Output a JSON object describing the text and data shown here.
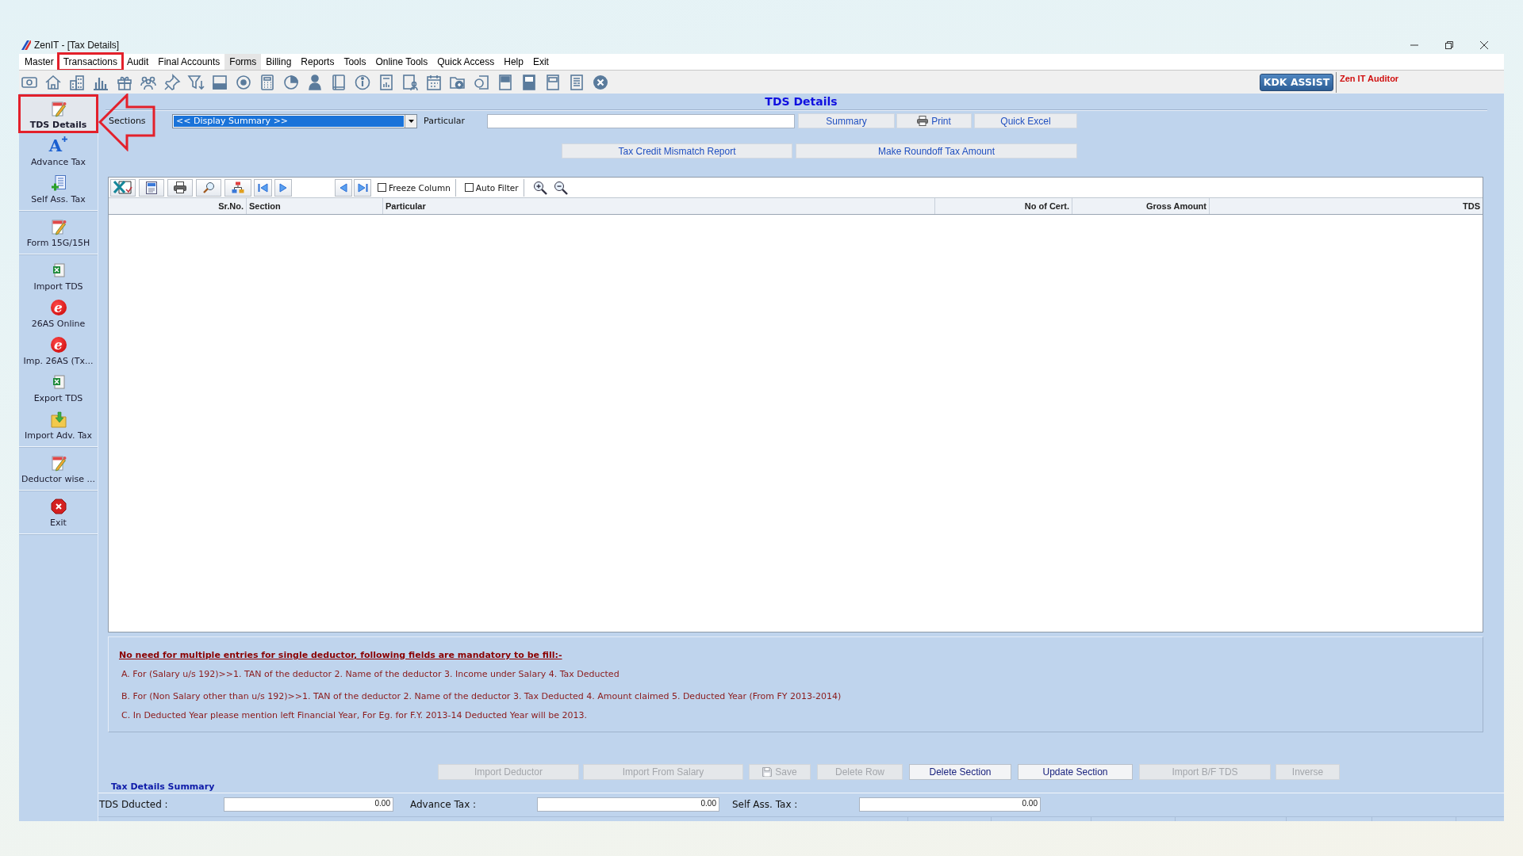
{
  "window": {
    "title": "ZenIT - [Tax Details]"
  },
  "menu": [
    {
      "label": "Master",
      "hover": false,
      "annotated": false
    },
    {
      "label": "Transactions",
      "hover": false,
      "annotated": true
    },
    {
      "label": "Audit",
      "hover": false,
      "annotated": false
    },
    {
      "label": "Final Accounts",
      "hover": false,
      "annotated": false
    },
    {
      "label": "Forms",
      "hover": true,
      "annotated": false
    },
    {
      "label": "Billing",
      "hover": false,
      "annotated": false
    },
    {
      "label": "Reports",
      "hover": false,
      "annotated": false
    },
    {
      "label": "Tools",
      "hover": false,
      "annotated": false
    },
    {
      "label": "Online Tools",
      "hover": false,
      "annotated": false
    },
    {
      "label": "Quick Access",
      "hover": false,
      "annotated": false
    },
    {
      "label": "Help",
      "hover": false,
      "annotated": false
    },
    {
      "label": "Exit",
      "hover": false,
      "annotated": false
    }
  ],
  "toolbar": {
    "assist_button": "KDK ASSIST",
    "product": "Zen IT Auditor"
  },
  "sidebar": {
    "groups": [
      {
        "items": [
          {
            "label": "TDS Details",
            "kind": "tax-note",
            "selected": true,
            "annotated": true
          },
          {
            "label": "Advance Tax",
            "kind": "glyph",
            "glyph": "A",
            "selected": false,
            "annotated": false
          },
          {
            "label": "Self Ass. Tax",
            "kind": "document-plus",
            "selected": false,
            "annotated": false
          }
        ]
      },
      {
        "items": [
          {
            "label": "Form 15G/15H",
            "kind": "tax-note",
            "selected": false,
            "annotated": false
          }
        ]
      },
      {
        "items": [
          {
            "label": "Import TDS",
            "kind": "spreadsheet",
            "selected": false,
            "annotated": false
          },
          {
            "label": "26AS Online",
            "kind": "e-logo",
            "glyph": "e",
            "selected": false,
            "annotated": false
          },
          {
            "label": "Imp. 26AS (Tx...",
            "kind": "e-logo",
            "glyph": "e",
            "selected": false,
            "annotated": false
          },
          {
            "label": "Export TDS",
            "kind": "spreadsheet",
            "selected": false,
            "annotated": false
          },
          {
            "label": "Import Adv. Tax",
            "kind": "folder-arrow",
            "selected": false,
            "annotated": false
          }
        ]
      },
      {
        "items": [
          {
            "label": "Deductor wise ...",
            "kind": "tax-note",
            "selected": false,
            "annotated": false
          }
        ]
      },
      {
        "items": [
          {
            "label": "Exit",
            "kind": "stop",
            "selected": false,
            "annotated": false
          }
        ]
      }
    ]
  },
  "heading": "TDS Details",
  "filters": {
    "sections_label": "Sections",
    "sections_value": "<< Display Summary >>",
    "particular_label": "Particular"
  },
  "top_buttons": [
    {
      "label": "Summary",
      "kind": "plain"
    },
    {
      "label": "Print",
      "kind": "print"
    },
    {
      "label": "Quick Excel",
      "kind": "plain"
    }
  ],
  "report_buttons": [
    "Tax Credit Mismatch Report",
    "Make Roundoff Tax Amount"
  ],
  "grid": {
    "options": [
      {
        "label": "Freeze Column",
        "checked": false
      },
      {
        "label": "Auto Filter",
        "checked": false
      }
    ],
    "columns": [
      {
        "label": "Sr.No.",
        "kind": "number"
      },
      {
        "label": "Section",
        "kind": "text"
      },
      {
        "label": "Particular",
        "kind": "text"
      },
      {
        "label": "No of Cert.",
        "kind": "number"
      },
      {
        "label": "Gross Amount",
        "kind": "number"
      },
      {
        "label": "TDS",
        "kind": "number"
      }
    ]
  },
  "notes": {
    "title": "No need for multiple entries for single deductor, following fields are mandatory to be fill:-",
    "lines": [
      "A. For (Salary u/s 192)>>1. TAN of the deductor 2. Name of the deductor 3. Income under Salary 4. Tax Deducted",
      "B. For (Non Salary other than u/s 192)>>1. TAN of the deductor 2. Name of the deductor 3. Tax Deducted 4. Amount claimed 5. Deducted Year (From FY 2013-2014)",
      "C. In Deducted Year please mention left Financial Year, For Eg. for F.Y. 2013-14 Deducted Year will be 2013."
    ]
  },
  "actions": [
    {
      "label": "Import Deductor",
      "kind": "plain",
      "disabled": true
    },
    {
      "label": "Import From Salary",
      "kind": "plain",
      "disabled": true
    },
    {
      "label": "Save",
      "kind": "save",
      "disabled": true
    },
    {
      "label": "Delete Row",
      "kind": "plain",
      "disabled": true
    },
    {
      "label": "Delete Section",
      "kind": "plain",
      "disabled": false
    },
    {
      "label": "Update Section",
      "kind": "plain",
      "disabled": false
    },
    {
      "label": "Import B/F TDS",
      "kind": "plain",
      "disabled": true
    },
    {
      "label": "Inverse",
      "kind": "plain",
      "disabled": true
    }
  ],
  "summary": {
    "title": "Tax Details Summary",
    "fields": [
      {
        "label": "TDS Dducted :",
        "value": "0.00"
      },
      {
        "label": "Advance Tax :",
        "value": "0.00"
      },
      {
        "label": "Self Ass. Tax :",
        "value": "0.00"
      }
    ]
  }
}
